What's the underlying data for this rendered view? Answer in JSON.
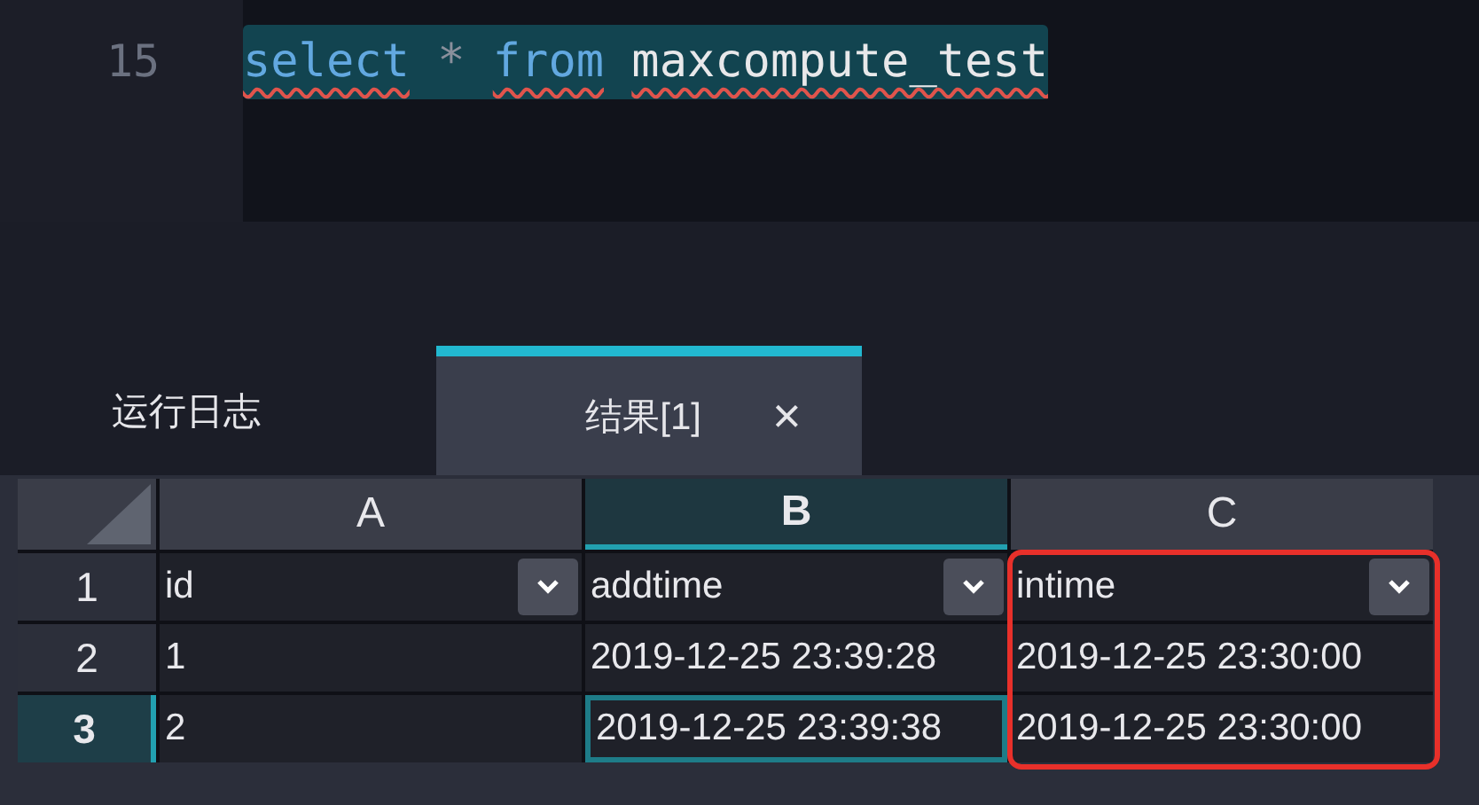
{
  "editor": {
    "lines": [
      {
        "number": "15",
        "highlighted": true,
        "tokens": [
          {
            "text": "select",
            "kind": "keyword",
            "error": true
          },
          {
            "text": "*",
            "kind": "operator",
            "error": false
          },
          {
            "text": "from",
            "kind": "keyword",
            "error": true
          },
          {
            "text": "maxcompute_test",
            "kind": "identifier",
            "error": true
          }
        ]
      }
    ]
  },
  "tabs": [
    {
      "label": "运行日志",
      "selected": false
    },
    {
      "label": "结果[1]",
      "selected": true,
      "close": "×"
    }
  ],
  "grid": {
    "columns": [
      {
        "label": "A",
        "selected": false,
        "annotated": false
      },
      {
        "label": "B",
        "selected": true,
        "annotated": false
      },
      {
        "label": "C",
        "selected": false,
        "annotated": true
      }
    ],
    "rows": [
      {
        "label": "1",
        "selected": false,
        "cells": [
          {
            "text": "id",
            "filter": true,
            "selected": false
          },
          {
            "text": "addtime",
            "filter": true,
            "selected": false
          },
          {
            "text": "intime",
            "filter": true,
            "selected": false
          }
        ]
      },
      {
        "label": "2",
        "selected": false,
        "cells": [
          {
            "text": "1",
            "filter": false,
            "selected": false
          },
          {
            "text": "2019-12-25 23:39:28",
            "filter": false,
            "selected": false
          },
          {
            "text": "2019-12-25 23:30:00",
            "filter": false,
            "selected": false
          }
        ]
      },
      {
        "label": "3",
        "selected": true,
        "cells": [
          {
            "text": "2",
            "filter": false,
            "selected": false
          },
          {
            "text": "2019-12-25 23:39:38",
            "filter": false,
            "selected": true
          },
          {
            "text": "2019-12-25 23:30:00",
            "filter": false,
            "selected": false
          }
        ]
      }
    ]
  }
}
